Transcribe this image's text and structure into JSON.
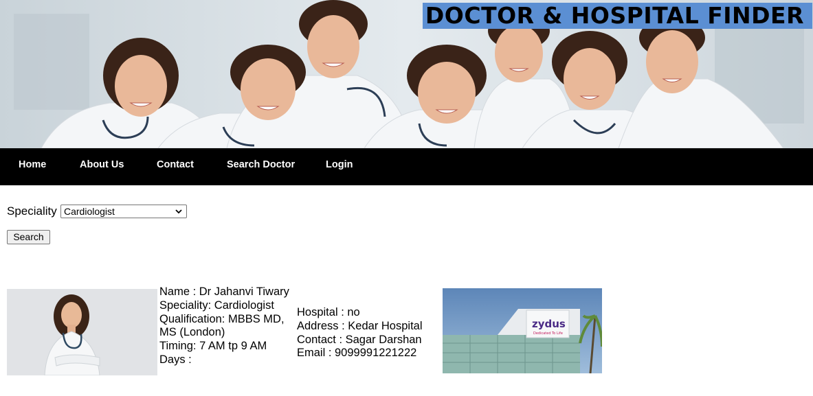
{
  "header": {
    "title": "DOCTOR & HOSPITAL FINDER"
  },
  "nav": {
    "items": [
      {
        "label": "Home"
      },
      {
        "label": "About Us"
      },
      {
        "label": "Contact"
      },
      {
        "label": "Search Doctor"
      },
      {
        "label": "Login"
      }
    ]
  },
  "search": {
    "speciality_label": "Speciality",
    "speciality_value": "Cardiologist",
    "button_label": "Search"
  },
  "result": {
    "doctor": {
      "name": "Name : Dr Jahanvi Tiwary",
      "speciality": "Speciality: Cardiologist",
      "qualification": "Qualification: MBBS MD, MS (London)",
      "timing": "Timing: 7 AM tp 9 AM",
      "days": "Days :"
    },
    "hospital": {
      "hospital": "Hospital : no",
      "address": "Address : Kedar Hospital",
      "contact": "Contact : Sagar Darshan",
      "email": "Email : 9099991221222"
    },
    "hospital_sign_text": "zydus",
    "hospital_sign_tagline": "Dedicated To Life"
  },
  "colors": {
    "title_bg": "#5b8fd3",
    "nav_bg": "#000000",
    "nav_text": "#ffffff"
  }
}
